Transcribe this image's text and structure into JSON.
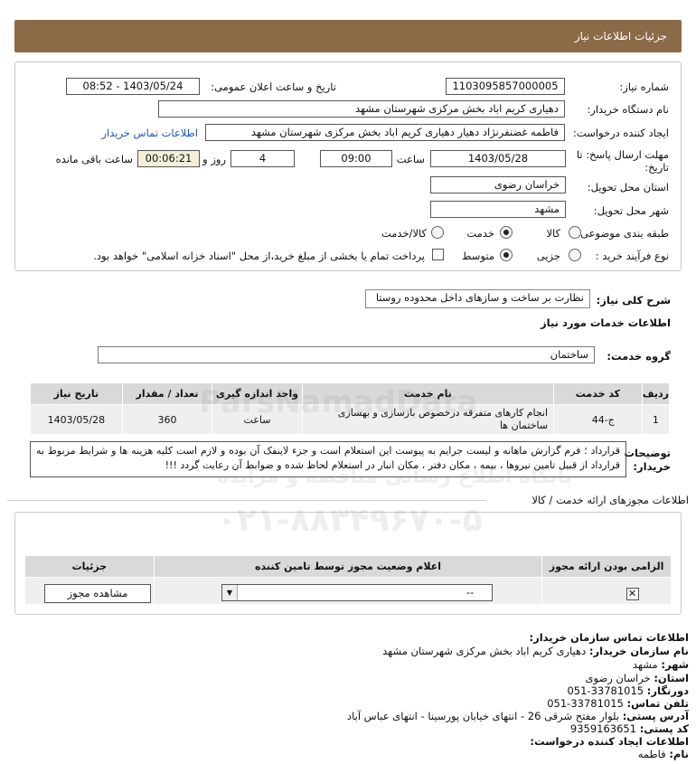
{
  "header": {
    "title": "جزئیات اطلاعات نیاز"
  },
  "form": {
    "need_number_label": "شماره نیاز:",
    "need_number": "1103095857000005",
    "announce_label": "تاریخ و ساعت اعلان عمومی:",
    "announce_value": "1403/05/24 - 08:52",
    "buyer_org_label": "نام دستگاه خریدار:",
    "buyer_org": "دهیاری کریم اباد بخش مرکزی شهرستان مشهد",
    "creator_label": "ایجاد کننده درخواست:",
    "creator": "فاطمه غضنفرنژاد دهیار دهیاری کریم اباد بخش مرکزی شهرستان مشهد",
    "contact_link": "اطلاعات تماس خریدار",
    "deadline_label_1": "مهلت ارسال پاسخ: تا",
    "deadline_label_2": "تاریخ:",
    "deadline_date": "1403/05/28",
    "time_label": "ساعت",
    "deadline_time": "09:00",
    "days_value": "4",
    "days_label": "روز و",
    "remaining_time": "00:06:21",
    "remaining_label": "ساعت باقی مانده",
    "province_label": "استان محل تحویل:",
    "province": "خراسان رضوی",
    "city_label": "شهر محل تحویل:",
    "city": "مشهد",
    "category_label": "طبقه بندی موضوعی:",
    "category_options": [
      "کالا",
      "خدمت",
      "کالا/خدمت"
    ],
    "category_selected": "خدمت",
    "process_label": "نوع فرآیند خرید :",
    "process_options": [
      "جزیی",
      "متوسط"
    ],
    "process_selected": "متوسط",
    "payment_note": "پرداخت تمام یا بخشی از مبلغ خرید،از محل \"اسناد خزانه اسلامی\" خواهد بود."
  },
  "summary": {
    "label": "شرح کلی نیاز:",
    "value": "نظارت بر ساخت و سازهای داخل محدوده روستا",
    "services_heading": "اطلاعات خدمات مورد نیاز",
    "group_label": "گروه خدمت:",
    "group_value": "ساختمان"
  },
  "service_table": {
    "headers": [
      "ردیف",
      "کد خدمت",
      "نام خدمت",
      "واحد اندازه گیری",
      "تعداد / مقدار",
      "تاریخ نیاز"
    ],
    "rows": [
      {
        "row": "1",
        "code": "ج-44",
        "name": "انجام کارهای متفرقه درخصوص بازسازی و بهسازی ساختمان ها",
        "unit": "ساعت",
        "qty": "360",
        "date": "1403/05/28"
      }
    ]
  },
  "notes": {
    "label_1": "توضیحات",
    "label_2": "خریدار:",
    "text": "قرارداد ؛ فرم گزارش ماهانه و لیست جرایم به پیوست این استعلام است و جزء لاینفک آن بوده و لازم است کلیه هزینه ها و شرایط مربوط به قرارداد از قبیل تامین نیروها ، بیمه ، مکان دفتر ، مکان انبار در استعلام لحاظ شده و ضوابط آن رعایت گردد !!!"
  },
  "permits": {
    "title": "اطلاعات مجوزهای ارائه خدمت / کالا",
    "headers": [
      "الزامی بودن ارائه مجوز",
      "اعلام وضعیت مجوز توسط تامین کننده",
      "جزئیات"
    ],
    "select_value": "--",
    "view_button": "مشاهده مجوز"
  },
  "contact": {
    "heading": "اطلاعات تماس سازمان خریدار:",
    "org_label": "نام سازمان خریدار:",
    "org_value": "دهیاری کریم اباد بخش مرکزی شهرستان مشهد",
    "city_label": "شهر:",
    "city_value": "مشهد",
    "province_label": "استان:",
    "province_value": "خراسان رضوی",
    "fax_label": "دورنگار:",
    "fax_value": "33781015-051",
    "phone_label": "تلفن تماس:",
    "phone_value": "33781015-051",
    "address_label": "آدرس پستی:",
    "address_value": "بلوار مفتح شرقی 26 - انتهای خیابان پورسینا - انتهای عباس آباد",
    "postal_label": "کد پستی:",
    "postal_value": "9359163651",
    "creator_heading": "اطلاعات ایجاد کننده درخواست:",
    "name_label": "نام:",
    "name_value": "فاطمه"
  },
  "watermark": {
    "line1": "ParsNamadData",
    "line2": "پایگاه اطلاع رسانی مناقصه و مزایده",
    "line3": "۰۲۱-۸۸۳۴۹۶۷۰-۵"
  }
}
